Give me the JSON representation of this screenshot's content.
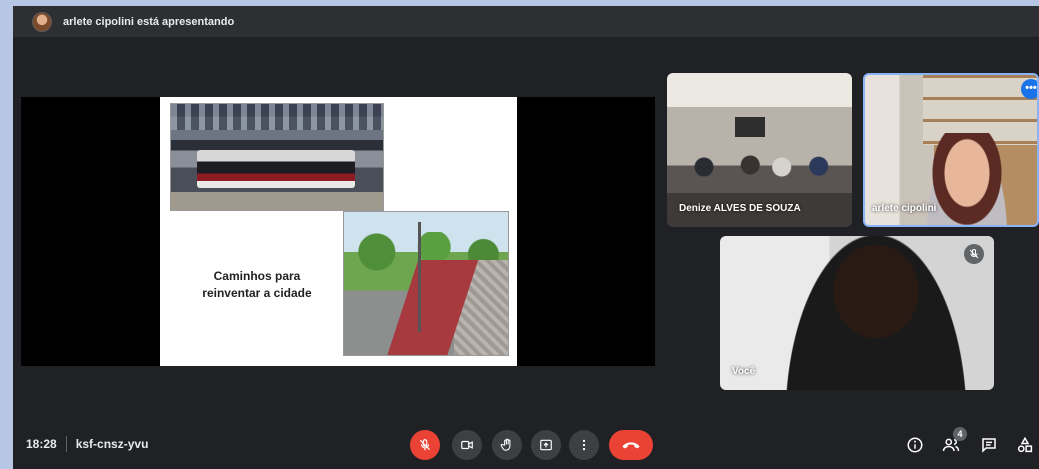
{
  "presenter_bar": {
    "text": "arlete cipolini está apresentando",
    "avatar_icon": "user-avatar"
  },
  "slide": {
    "caption_line1": "Caminhos para",
    "caption_line2": "reinventar a cidade"
  },
  "participants": [
    {
      "name": "Denize ALVES DE SOUZA"
    },
    {
      "name": "arlete cipolini",
      "more_icon": "•••"
    },
    {
      "name": "Você",
      "mic_muted": true
    }
  ],
  "meeting": {
    "time": "18:28",
    "code": "ksf-cnsz-yvu"
  },
  "controls": {
    "mic": "mic-off-icon",
    "camera": "camera-icon",
    "hand": "raise-hand-icon",
    "present": "present-icon",
    "more": "more-vert-icon",
    "hangup": "hangup-icon"
  },
  "right_controls": {
    "people_count": "4"
  },
  "colors": {
    "background": "#202124",
    "danger": "#ea4335",
    "accent": "#1a73e8",
    "outer": "#b7c6e4"
  }
}
